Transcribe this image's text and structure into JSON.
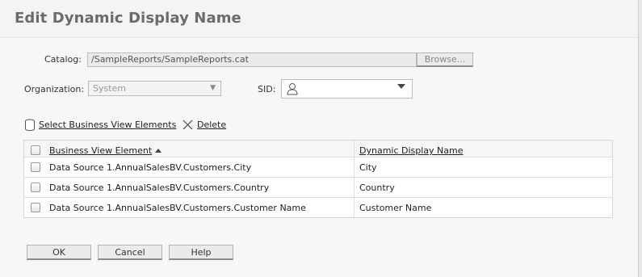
{
  "dialog": {
    "title": "Edit Dynamic Display Name"
  },
  "form": {
    "catalog_label": "Catalog:",
    "catalog_value": "/SampleReports/SampleReports.cat",
    "browse_label": "Browse...",
    "organization_label": "Organization:",
    "organization_value": "System",
    "sid_label": "SID:",
    "sid_value": ""
  },
  "toolbar": {
    "select_label": "Select Business View Elements",
    "delete_label": "Delete"
  },
  "table": {
    "columns": [
      "Business View Element",
      "Dynamic Display Name"
    ],
    "sort_column": "Business View Element",
    "sort_direction": "ascending",
    "rows": [
      {
        "element": "Data Source 1.AnnualSalesBV.Customers.City",
        "display_name": "City"
      },
      {
        "element": "Data Source 1.AnnualSalesBV.Customers.Country",
        "display_name": "Country"
      },
      {
        "element": "Data Source 1.AnnualSalesBV.Customers.Customer Name",
        "display_name": "Customer Name"
      }
    ]
  },
  "buttons": {
    "ok": "OK",
    "cancel": "Cancel",
    "help": "Help"
  },
  "icons": {
    "database": "database-icon",
    "delete": "close-icon",
    "user": "user-icon",
    "dropdown": "chevron-down-icon",
    "sort": "sort-ascending-icon"
  }
}
